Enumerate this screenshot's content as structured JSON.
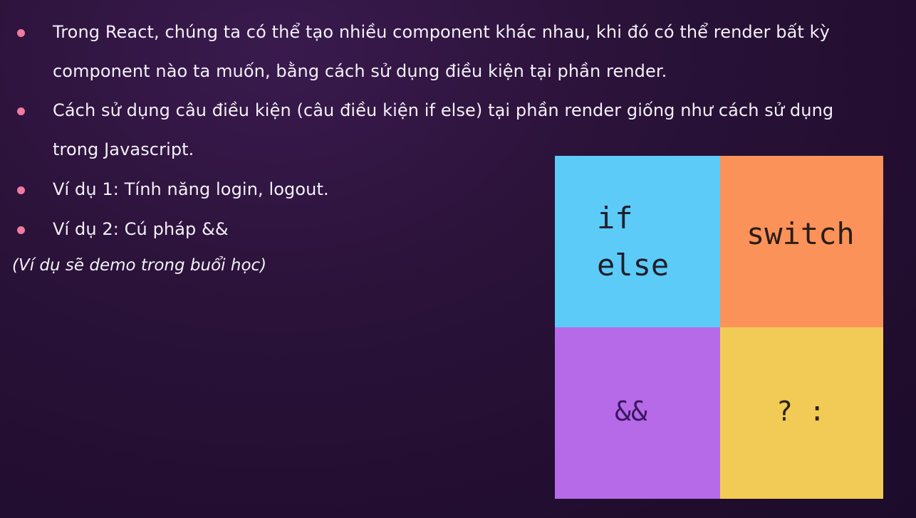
{
  "bullets": [
    {
      "lines": [
        "Trong React, chúng ta có thể tạo nhiều component khác nhau, khi đó có thể render bất kỳ",
        "component nào ta muốn, bằng cách sử dụng điều kiện tại phần render."
      ]
    },
    {
      "lines": [
        "Cách sử dụng câu điều kiện (câu điều kiện if else) tại phần render giống như cách sử dụng",
        "trong Javascript."
      ]
    },
    {
      "lines": [
        "Ví dụ 1: Tính năng login, logout."
      ]
    },
    {
      "lines": [
        "Ví dụ 2: Cú pháp &&"
      ]
    }
  ],
  "note": "(Ví dụ sẽ demo trong buổi học)",
  "grid": {
    "if_line1": "if",
    "if_line2": "else",
    "switch": "switch",
    "and": "&&",
    "ternary": "? :"
  },
  "colors": {
    "background": "#2a1238",
    "bullet_dot": "#f07aa0",
    "cell_if": "#5ccbf7",
    "cell_switch": "#fb9259",
    "cell_and": "#b66ae8",
    "cell_ternary": "#f1cb55"
  }
}
